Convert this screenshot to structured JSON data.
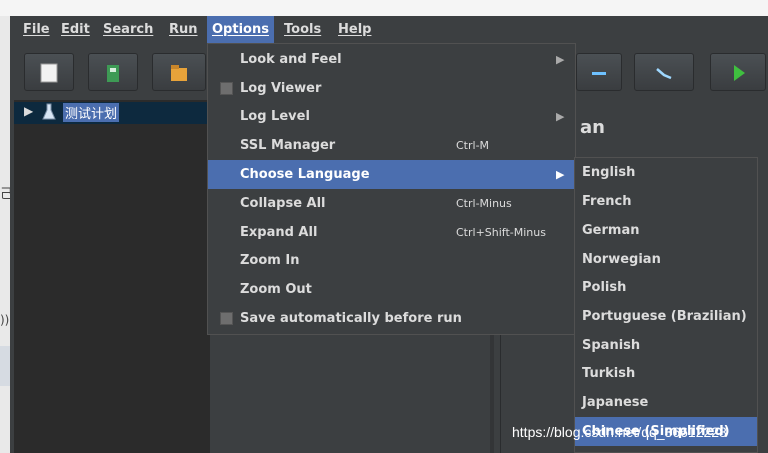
{
  "menubar": {
    "items": [
      {
        "label": "File"
      },
      {
        "label": "Edit"
      },
      {
        "label": "Search"
      },
      {
        "label": "Run"
      },
      {
        "label": "Options"
      },
      {
        "label": "Tools"
      },
      {
        "label": "Help"
      }
    ]
  },
  "tree": {
    "root_label": "测试计划"
  },
  "side_panel": {
    "title_fragment": "an"
  },
  "left_fragments": [
    "己",
    "))"
  ],
  "options_menu": {
    "items": [
      {
        "label": "Look and Feel",
        "submenu": true
      },
      {
        "label": "Log Viewer",
        "checkbox": true
      },
      {
        "label": "Log Level",
        "submenu": true
      },
      {
        "label": "SSL Manager",
        "shortcut": "Ctrl-M"
      },
      {
        "label": "Choose Language",
        "submenu": true,
        "highlighted": true
      },
      {
        "label": "Collapse All",
        "shortcut": "Ctrl-Minus"
      },
      {
        "label": "Expand All",
        "shortcut": "Ctrl+Shift-Minus"
      },
      {
        "label": "Zoom In"
      },
      {
        "label": "Zoom Out"
      },
      {
        "label": "Save automatically before run",
        "checkbox": true
      }
    ]
  },
  "language_menu": {
    "items": [
      {
        "label": "English"
      },
      {
        "label": "French"
      },
      {
        "label": "German"
      },
      {
        "label": "Norwegian"
      },
      {
        "label": "Polish"
      },
      {
        "label": "Portuguese (Brazilian)"
      },
      {
        "label": "Spanish"
      },
      {
        "label": "Turkish"
      },
      {
        "label": "Japanese"
      },
      {
        "label": "Chinese (Simplified)",
        "highlighted": true
      }
    ]
  },
  "watermark": "https://blog.csdn.net/qq_36612228",
  "colors": {
    "highlight": "#4b6eaf",
    "background": "#3c3f41",
    "start_green": "#3fbf3f"
  },
  "icons": [
    "new-plan-icon",
    "templates-icon",
    "open-icon",
    "remove-icon",
    "toggle-icon",
    "start-icon",
    "tree-expand-icon",
    "test-plan-icon",
    "submenu-arrow-icon"
  ]
}
